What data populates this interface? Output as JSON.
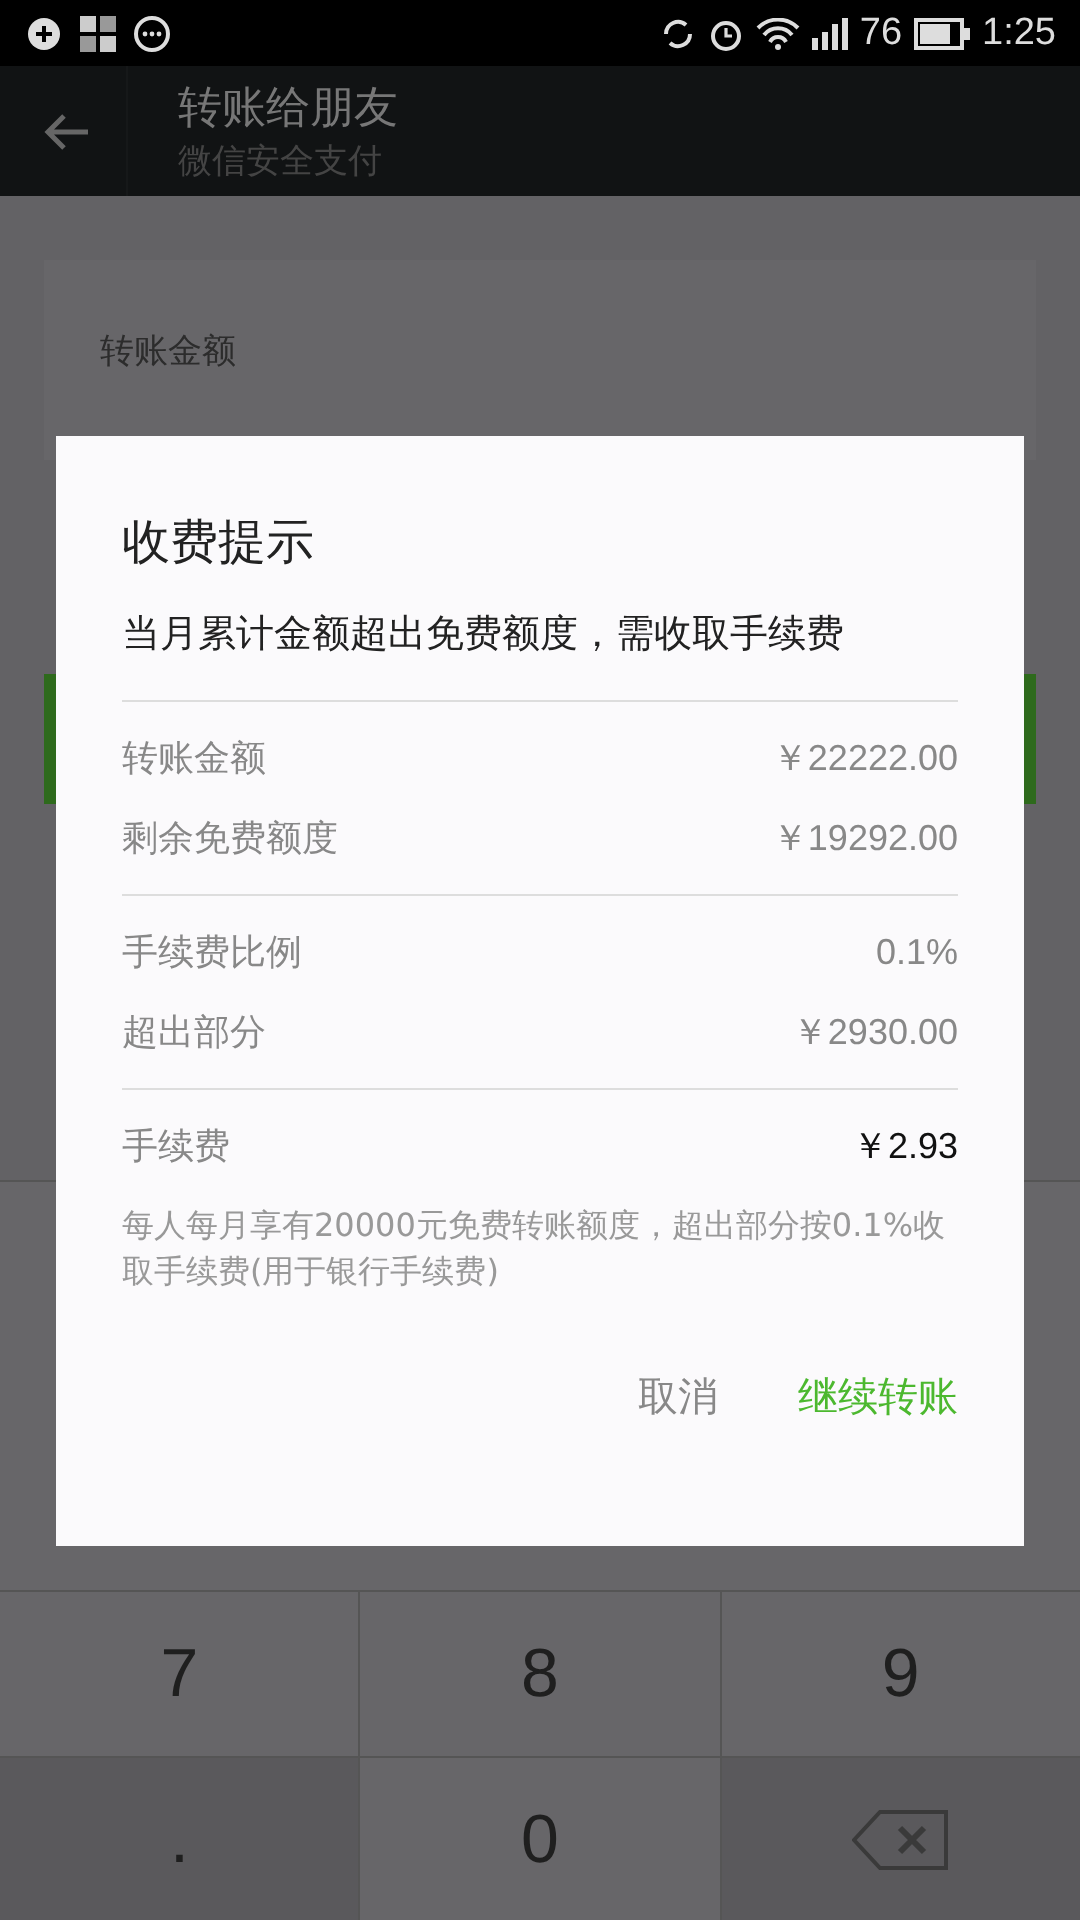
{
  "status_bar": {
    "battery_text": "76",
    "time": "1:25"
  },
  "header": {
    "title": "转账给朋友",
    "subtitle": "微信安全支付"
  },
  "amount_card": {
    "label": "转账金额"
  },
  "keypad": {
    "keys": [
      {
        "label": "7",
        "kind": "digit"
      },
      {
        "label": "8",
        "kind": "digit"
      },
      {
        "label": "9",
        "kind": "digit"
      },
      {
        "label": ".",
        "kind": "dot"
      },
      {
        "label": "0",
        "kind": "digit"
      },
      {
        "kind": "backspace"
      }
    ]
  },
  "dialog": {
    "title": "收费提示",
    "message": "当月累计金额超出免费额度，需收取手续费",
    "groups": [
      [
        {
          "label": "转账金额",
          "value": "￥22222.00",
          "emphasis": false
        },
        {
          "label": "剩余免费额度",
          "value": "￥19292.00",
          "emphasis": false
        }
      ],
      [
        {
          "label": "手续费比例",
          "value": "0.1%",
          "emphasis": false
        },
        {
          "label": "超出部分",
          "value": "￥2930.00",
          "emphasis": false
        }
      ],
      [
        {
          "label": "手续费",
          "value": "￥2.93",
          "emphasis": true
        }
      ]
    ],
    "note": "每人每月享有20000元免费转账额度，超出部分按0.1%收取手续费(用于银行手续费)",
    "buttons": [
      {
        "label": "取消",
        "kind": "cancel"
      },
      {
        "label": "继续转账",
        "kind": "confirm"
      }
    ]
  }
}
